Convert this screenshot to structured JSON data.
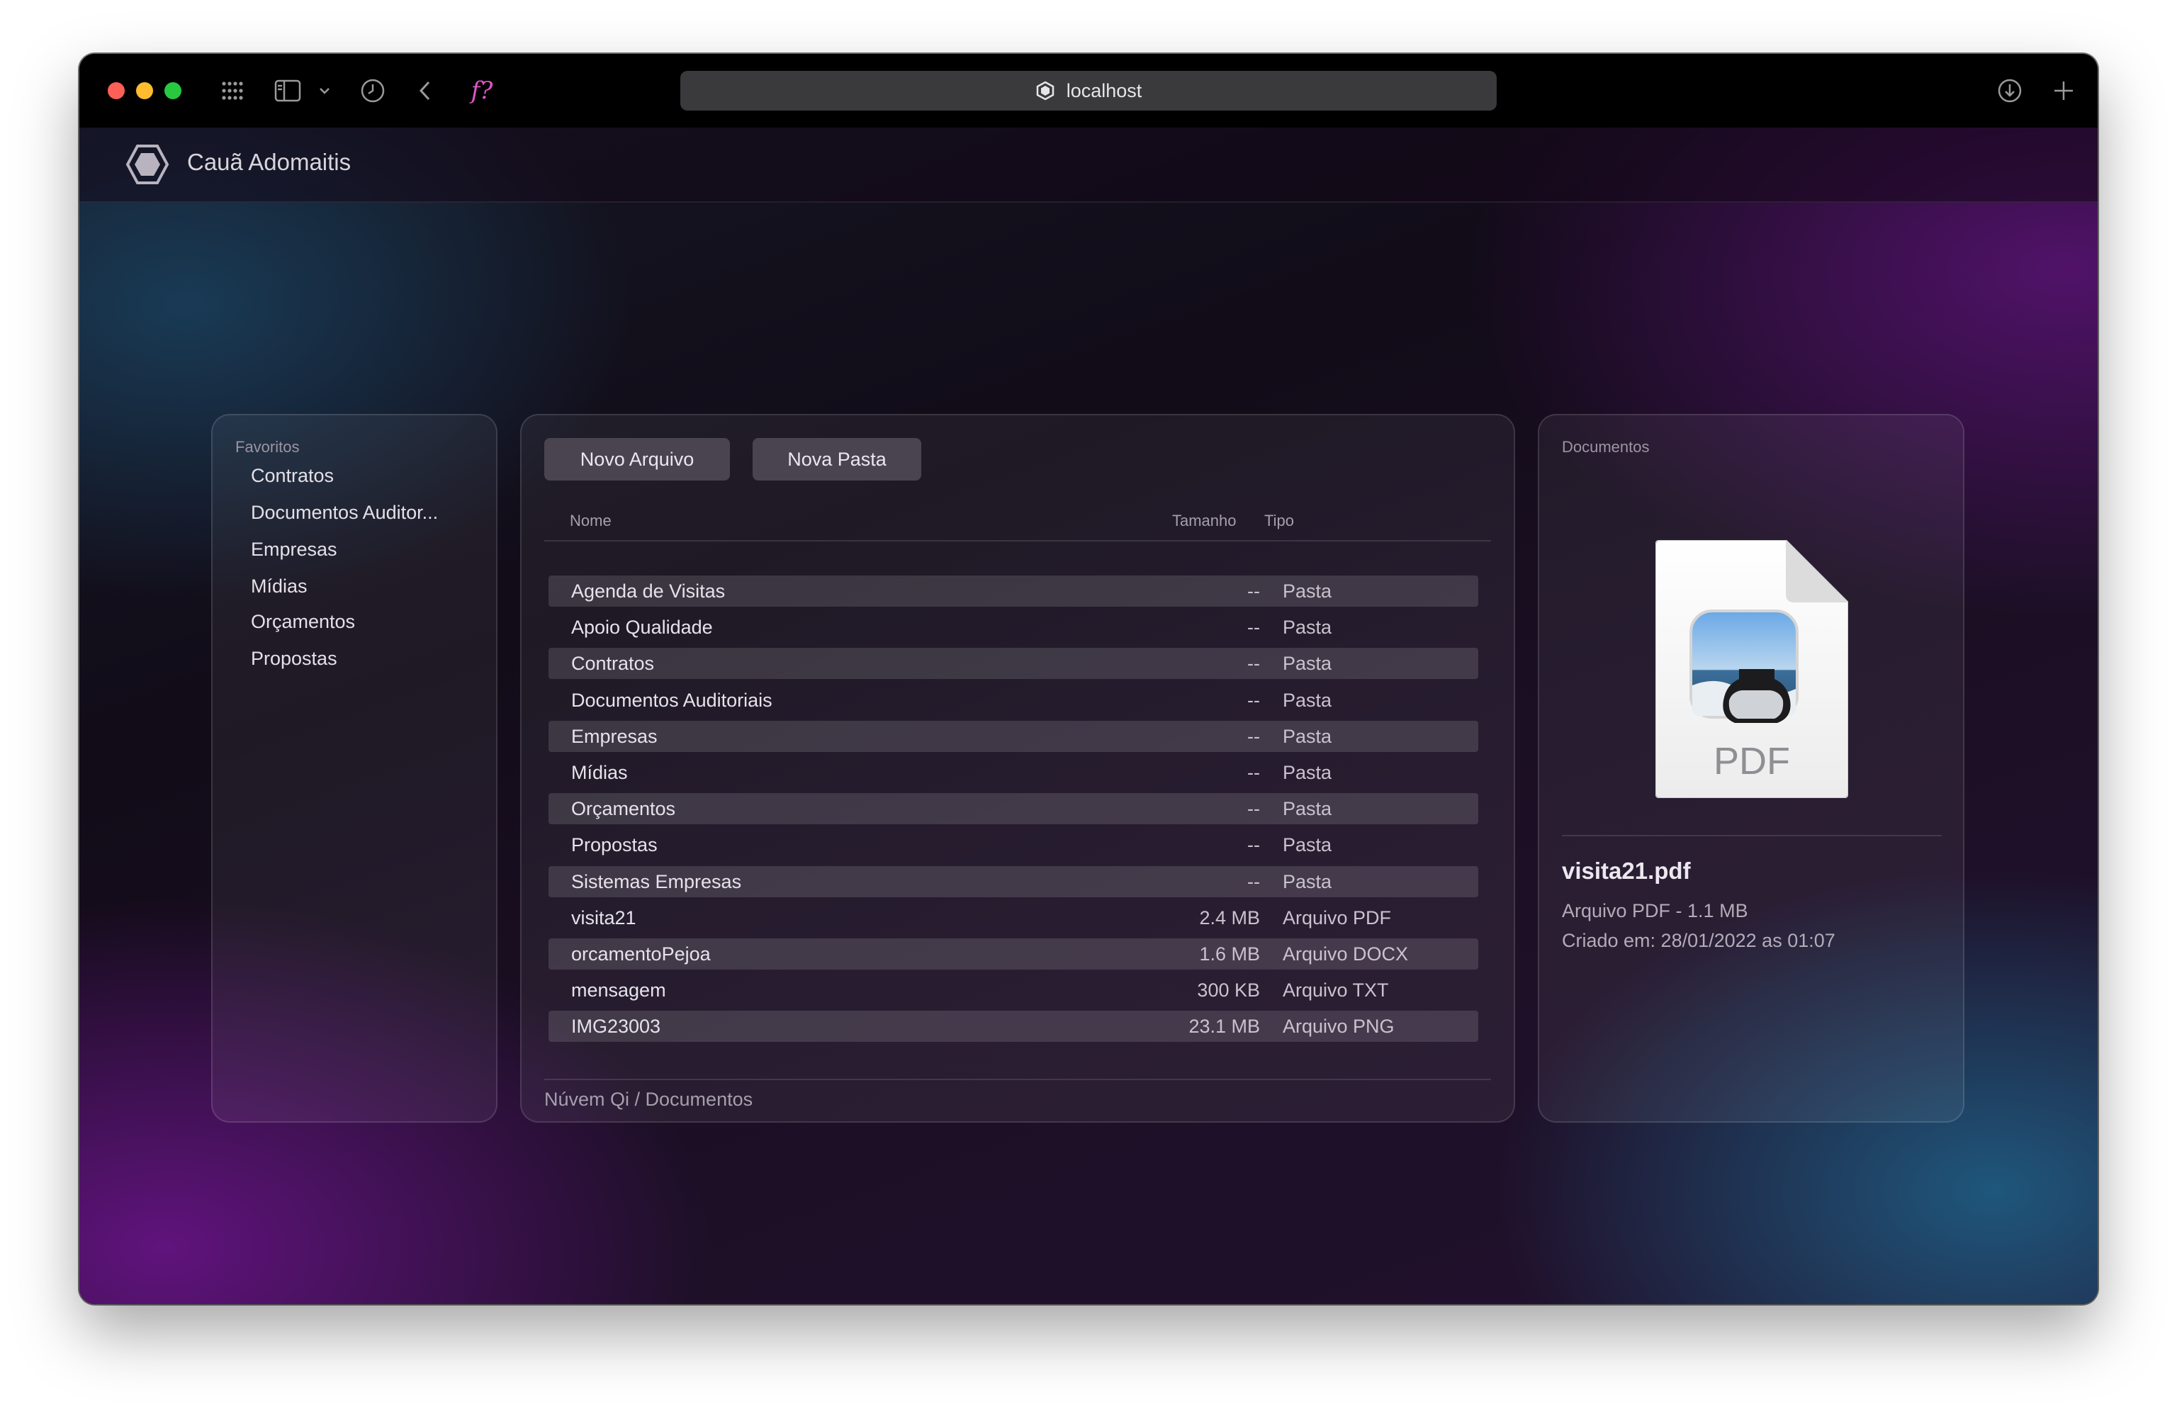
{
  "browser": {
    "address": "localhost",
    "icons": [
      "apps-grid-icon",
      "sidebar-icon",
      "chevron-down-icon",
      "history-icon",
      "back-icon",
      "fx-extension-icon",
      "download-icon",
      "new-tab-icon"
    ],
    "fx_label": "f?"
  },
  "app": {
    "title": "Cauã Adomaitis",
    "logo": "hexagon-logo-icon"
  },
  "favorites": {
    "label": "Favoritos",
    "items": [
      "Contratos",
      "Documentos Auditor...",
      "Empresas",
      "Mídias",
      "Orçamentos",
      "Propostas"
    ]
  },
  "files": {
    "buttons": {
      "new_file": "Novo Arquivo",
      "new_folder": "Nova Pasta"
    },
    "columns": {
      "name": "Nome",
      "size": "Tamanho",
      "type": "Tipo"
    },
    "rows": [
      {
        "name": "Agenda de Visitas",
        "size": "--",
        "type": "Pasta"
      },
      {
        "name": "Apoio Qualidade",
        "size": "--",
        "type": "Pasta"
      },
      {
        "name": "Contratos",
        "size": "--",
        "type": "Pasta"
      },
      {
        "name": "Documentos Auditoriais",
        "size": "--",
        "type": "Pasta"
      },
      {
        "name": "Empresas",
        "size": "--",
        "type": "Pasta"
      },
      {
        "name": "Mídias",
        "size": "--",
        "type": "Pasta"
      },
      {
        "name": "Orçamentos",
        "size": "--",
        "type": "Pasta"
      },
      {
        "name": "Propostas",
        "size": "--",
        "type": "Pasta"
      },
      {
        "name": "Sistemas Empresas",
        "size": "--",
        "type": "Pasta"
      },
      {
        "name": "visita21",
        "size": "2.4 MB",
        "type": "Arquivo PDF"
      },
      {
        "name": "orcamentoPejoa",
        "size": "1.6 MB",
        "type": "Arquivo DOCX"
      },
      {
        "name": "mensagem",
        "size": "300 KB",
        "type": "Arquivo TXT"
      },
      {
        "name": "IMG23003",
        "size": "23.1 MB",
        "type": "Arquivo PNG"
      }
    ],
    "breadcrumb": "Núvem Qi / Documentos"
  },
  "preview": {
    "label": "Documentos",
    "icon": "pdf-document-icon",
    "icon_text": "PDF",
    "file_name": "visita21.pdf",
    "meta": "Arquivo PDF - 1.1 MB",
    "created": "Criado em: 28/01/2022 as 01:07"
  },
  "colors": {
    "close": "#fe5f57",
    "minimize": "#febc2e",
    "maximize": "#28c840",
    "fx_accent": "#e055c8"
  }
}
